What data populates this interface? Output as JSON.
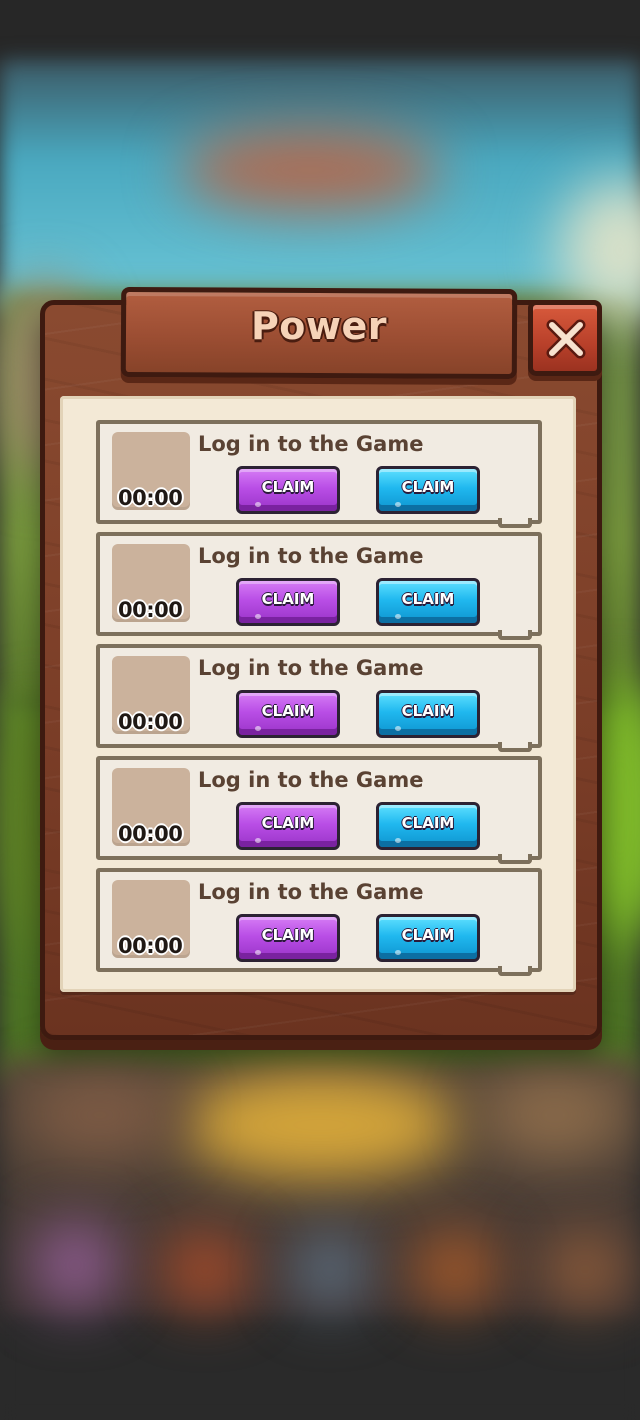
{
  "dialog": {
    "title": "Power",
    "close_icon": "close-x-icon"
  },
  "tasks": [
    {
      "title": "Log in to the Game",
      "timer": "00:00",
      "claim_purple_label": "CLAIM",
      "claim_blue_label": "CLAIM"
    },
    {
      "title": "Log in to the Game",
      "timer": "00:00",
      "claim_purple_label": "CLAIM",
      "claim_blue_label": "CLAIM"
    },
    {
      "title": "Log in to the Game",
      "timer": "00:00",
      "claim_purple_label": "CLAIM",
      "claim_blue_label": "CLAIM"
    },
    {
      "title": "Log in to the Game",
      "timer": "00:00",
      "claim_purple_label": "CLAIM",
      "claim_blue_label": "CLAIM"
    },
    {
      "title": "Log in to the Game",
      "timer": "00:00",
      "claim_purple_label": "CLAIM",
      "claim_blue_label": "CLAIM"
    }
  ],
  "colors": {
    "wood": "#8a4a30",
    "close_button": "#c8482e",
    "paper": "#f3e9d6",
    "claim_purple": "#b94ee6",
    "claim_blue": "#20b8ef"
  }
}
